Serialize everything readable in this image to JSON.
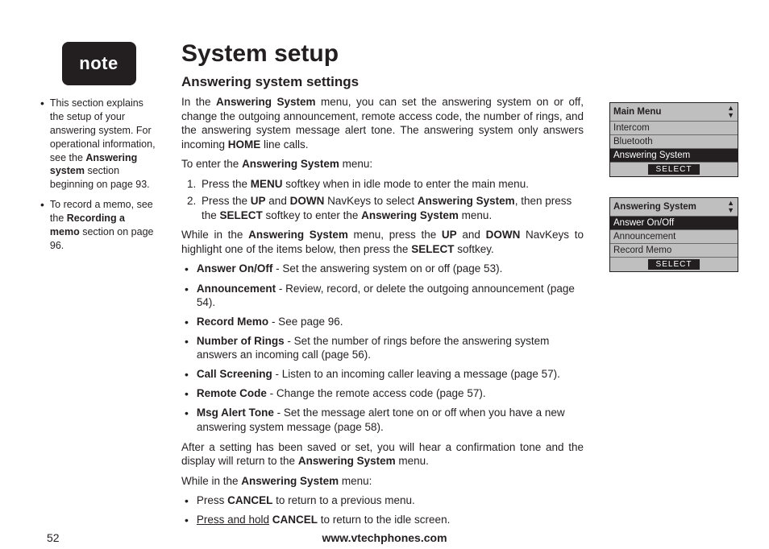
{
  "note": {
    "badge": "note",
    "items": [
      {
        "pre": "This section explains the setup of your answering system. For operational information, see the ",
        "b": "Answering system",
        "post": " section beginning on page 93."
      },
      {
        "pre": "To record a memo, see the ",
        "b": "Recording a memo",
        "post": " section on page 96."
      }
    ]
  },
  "title": "System setup",
  "subtitle": "Answering system settings",
  "intro": {
    "p1a": "In the ",
    "p1b": "Answering System",
    "p1c": " menu, you can set the answering system on or off, change the outgoing announcement, remote access code, the number of rings, and the answering system message alert tone. The answering system only answers incoming ",
    "p1d": "HOME",
    "p1e": " line calls."
  },
  "enter_line": {
    "a": "To enter the ",
    "b": "Answering System",
    "c": " menu:"
  },
  "steps": [
    {
      "a": "Press the ",
      "b": "MENU",
      "c": " softkey when in idle mode to enter the main menu."
    },
    {
      "a": "Press the ",
      "b": "UP",
      "c": " and ",
      "d": "DOWN",
      "e": " NavKeys to select ",
      "f": "Answering System",
      "g": ", then press the ",
      "h": "SELECT",
      "i": " softkey to enter the ",
      "j": "Answering System",
      "k": " menu."
    }
  ],
  "while": {
    "a": "While in the ",
    "b": "Answering System",
    "c": " menu, press the ",
    "d": "UP",
    "e": " and ",
    "f": "DOWN",
    "g": " NavKeys to highlight one of the items below, then press the ",
    "h": "SELECT",
    "i": " softkey."
  },
  "options": [
    {
      "b": "Answer On/Off",
      "t": " - Set the answering system on or off (page 53)."
    },
    {
      "b": "Announcement",
      "t": " - Review, record, or delete the outgoing announcement (page 54)."
    },
    {
      "b": "Record Memo",
      "t": " - See page 96."
    },
    {
      "b": "Number of Rings",
      "t": " - Set the number of rings before the answering system answers an incoming call (page 56)."
    },
    {
      "b": "Call Screening",
      "t": " - Listen to an incoming caller leaving a message (page 57)."
    },
    {
      "b": "Remote Code",
      "t": " - Change the remote access code (page 57)."
    },
    {
      "b": "Msg Alert Tone",
      "t": " - Set the message alert tone on or off when you have a new answering system message (page 58)."
    }
  ],
  "after": {
    "a": "After a setting has been saved or set, you will hear a confirmation tone and the display will return to the ",
    "b": "Answering System",
    "c": " menu."
  },
  "while2": {
    "a": "While in the ",
    "b": "Answering System",
    "c": " menu:"
  },
  "tail": [
    {
      "a": "Press ",
      "b": "CANCEL",
      "c": " to return to a previous menu."
    },
    {
      "ul_a": "Press and hold",
      "sp": " ",
      "b": "CANCEL",
      "c": " to return to the idle screen."
    }
  ],
  "footer": {
    "page": "52",
    "site": "www.vtechphones.com"
  },
  "screen1": {
    "title": "Main Menu",
    "rows": [
      "Intercom",
      "Bluetooth",
      "Answering System"
    ],
    "selected": 2,
    "btn": "SELECT"
  },
  "screen2": {
    "title": "Answering System",
    "rows": [
      "Answer On/Off",
      "Announcement",
      "Record Memo"
    ],
    "selected": 0,
    "btn": "SELECT"
  },
  "chart_data": null
}
